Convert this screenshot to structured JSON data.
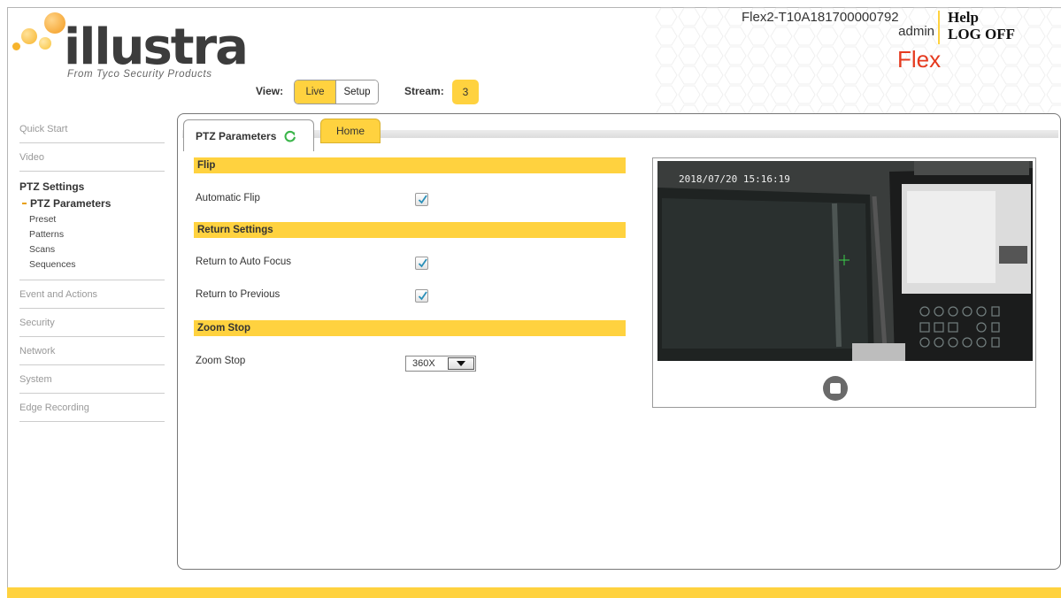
{
  "brand": {
    "logo_text": "illustra",
    "tagline": "From Tyco Security Products",
    "product": "Flex"
  },
  "header": {
    "view_label": "View:",
    "view_options": [
      "Live",
      "Setup"
    ],
    "stream_label": "Stream:",
    "stream_value": "3",
    "device_id": "Flex2-T10A181700000792",
    "user": "admin",
    "help": "Help",
    "logoff": "LOG OFF"
  },
  "sidebar": {
    "items_top": [
      "Quick Start",
      "Video"
    ],
    "group": {
      "title": "PTZ Settings",
      "items": [
        "PTZ Parameters",
        "Preset",
        "Patterns",
        "Scans",
        "Sequences"
      ],
      "active": "PTZ Parameters"
    },
    "items_bottom": [
      "Event and Actions",
      "Security",
      "Network",
      "System",
      "Edge Recording"
    ]
  },
  "tabs": {
    "active": "PTZ Parameters",
    "home": "Home"
  },
  "form": {
    "flip_header": "Flip",
    "automatic_flip_label": "Automatic Flip",
    "automatic_flip": true,
    "return_header": "Return Settings",
    "return_auto_focus_label": "Return to Auto Focus",
    "return_auto_focus": true,
    "return_previous_label": "Return to Previous",
    "return_previous": true,
    "zoom_header": "Zoom Stop",
    "zoom_stop_label": "Zoom Stop",
    "zoom_stop_value": "360X"
  },
  "video": {
    "timestamp": "2018/07/20 15:16:19"
  },
  "colors": {
    "accent": "#ffd23f",
    "brand_red": "#e53a1f",
    "refresh_green": "#3bb54a"
  }
}
